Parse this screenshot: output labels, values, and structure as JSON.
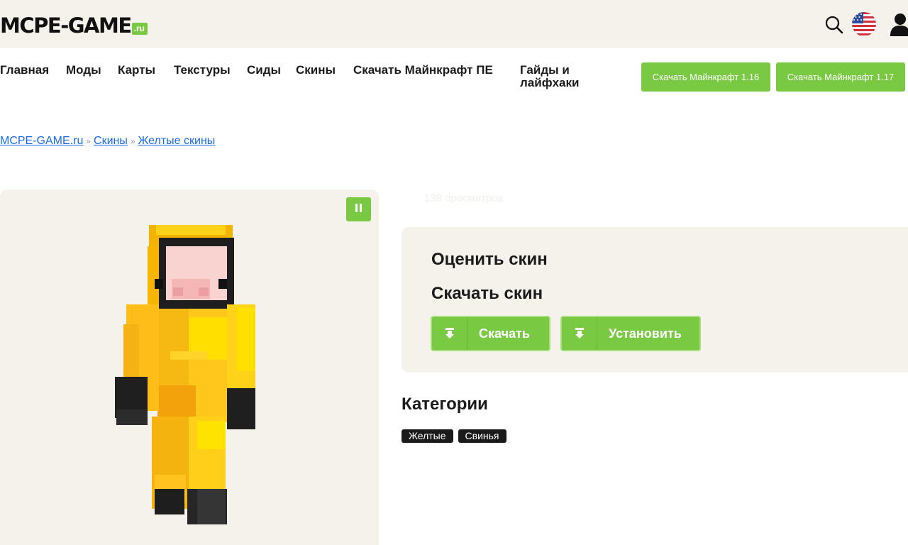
{
  "header": {
    "logo": {
      "main": "MCPE-GAME",
      "suffix": ".ru"
    },
    "icons": {
      "search": "search-icon",
      "language": "us-flag-icon",
      "account": "user-icon"
    }
  },
  "nav": {
    "items": [
      "Главная",
      "Моды",
      "Карты",
      "Текстуры",
      "Сиды",
      "Скины",
      "Скачать Майнкрафт ПЕ",
      "Гайды и лайфхаки"
    ],
    "buttons": [
      "Скачать Майнкрафт 1.16",
      "Скачать Майнкрафт 1.17"
    ]
  },
  "breadcrumb": {
    "items": [
      "MCPE-GAME.ru",
      "Скины",
      "Желтые скины"
    ],
    "separator": "»"
  },
  "preview": {
    "pause_icon": "pause-icon"
  },
  "stats": {
    "views": "138 просматров"
  },
  "skin_actions": {
    "rate_title": "Оценить скин",
    "download_title": "Скачать скин",
    "download_button": "Скачать",
    "install_button": "Установить"
  },
  "categories": {
    "title": "Категории",
    "tags": [
      "Желтые",
      "Свинья"
    ]
  },
  "colors": {
    "accent": "#7ac943",
    "panel": "#f5f2ec",
    "link": "#1a6ae6",
    "text": "#1b1b1b"
  }
}
